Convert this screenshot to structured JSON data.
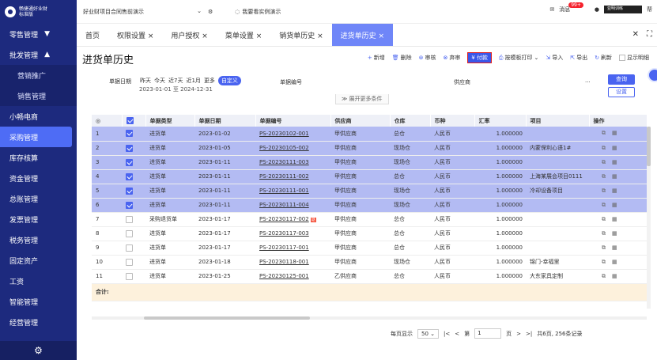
{
  "app": {
    "logo_line1": "畅捷通好业财",
    "logo_line2": "标准版"
  },
  "sidebar": {
    "items": [
      {
        "label": "零售管理",
        "arrow": "▼"
      },
      {
        "label": "批发管理",
        "arrow": "▲"
      },
      {
        "label": "营销推广"
      },
      {
        "label": "销售管理"
      },
      {
        "label": "小畅电商"
      },
      {
        "label": "采购管理"
      },
      {
        "label": "库存核算"
      },
      {
        "label": "资金管理"
      },
      {
        "label": "总账管理"
      },
      {
        "label": "发票管理"
      },
      {
        "label": "税务管理"
      },
      {
        "label": "固定资产"
      },
      {
        "label": "工资"
      },
      {
        "label": "智能管理"
      },
      {
        "label": "经营管理"
      }
    ],
    "bottom_icon": "gear-icon"
  },
  "topbar": {
    "project": "好业财项目合同售前演示",
    "demo_label": "我要看实例演示",
    "msg_label": "消息",
    "msg_count": "99+",
    "user": "亚明训练",
    "extra": "帮"
  },
  "tabs": [
    {
      "label": "首页"
    },
    {
      "label": "权限设置 ×"
    },
    {
      "label": "用户授权 ×"
    },
    {
      "label": "菜单设置 ×"
    },
    {
      "label": "销货单历史 ×"
    },
    {
      "label": "进货单历史 ×"
    }
  ],
  "page_title": "进货单历史",
  "actions": {
    "add": "新增",
    "delete": "删除",
    "audit": "审核",
    "abandon": "弃审",
    "pay": "付款",
    "print": "按模板打印",
    "import": "导入",
    "export": "导出",
    "refresh": "刷新",
    "show_detail": "显示明细"
  },
  "filter": {
    "date_label": "单据日期",
    "quick": [
      "昨天",
      "今天",
      "近7天",
      "近1月",
      "更多"
    ],
    "custom": "自定义",
    "range": "2023-01-01 至 2024-12-31",
    "code_label": "单据编号",
    "supplier_label": "供应商",
    "more": "...",
    "query": "查询",
    "settings": "设置",
    "expand": "≫ 展开更多条件"
  },
  "grid": {
    "headers": [
      "",
      "",
      "单据类型",
      "单据日期",
      "单据编号",
      "供应商",
      "仓库",
      "币种",
      "汇率",
      "项目",
      "操作"
    ],
    "rows": [
      {
        "n": "1",
        "sel": true,
        "type": "进货单",
        "date": "2023-01-02",
        "code": "PS-20230102-001",
        "supplier": "甲供应商",
        "wh": "总仓",
        "cur": "人民币",
        "rate": "1.000000",
        "proj": ""
      },
      {
        "n": "2",
        "sel": true,
        "type": "进货单",
        "date": "2023-01-05",
        "code": "PS-20230105-002",
        "supplier": "甲供应商",
        "wh": "现场仓",
        "cur": "人民币",
        "rate": "1.000000",
        "proj": "内蒙保利心语1#"
      },
      {
        "n": "3",
        "sel": true,
        "type": "进货单",
        "date": "2023-01-11",
        "code": "PS-20230111-003",
        "supplier": "甲供应商",
        "wh": "现场仓",
        "cur": "人民币",
        "rate": "1.000000",
        "proj": ""
      },
      {
        "n": "4",
        "sel": true,
        "type": "进货单",
        "date": "2023-01-11",
        "code": "PS-20230111-002",
        "supplier": "甲供应商",
        "wh": "总仓",
        "cur": "人民币",
        "rate": "1.000000",
        "proj": "上海某展会项目0111"
      },
      {
        "n": "5",
        "sel": true,
        "type": "进货单",
        "date": "2023-01-11",
        "code": "PS-20230111-001",
        "supplier": "甲供应商",
        "wh": "现场仓",
        "cur": "人民币",
        "rate": "1.000000",
        "proj": "冷却设备项目"
      },
      {
        "n": "6",
        "sel": true,
        "type": "进货单",
        "date": "2023-01-11",
        "code": "PS-20230111-004",
        "supplier": "甲供应商",
        "wh": "现场仓",
        "cur": "人民币",
        "rate": "1.000000",
        "proj": ""
      },
      {
        "n": "7",
        "sel": false,
        "type": "采购退货单",
        "date": "2023-01-17",
        "code": "PS-20230117-002",
        "refund": "退",
        "supplier": "甲供应商",
        "wh": "总仓",
        "cur": "人民币",
        "rate": "1.000000",
        "proj": ""
      },
      {
        "n": "8",
        "sel": false,
        "type": "进货单",
        "date": "2023-01-17",
        "code": "PS-20230117-003",
        "supplier": "甲供应商",
        "wh": "总仓",
        "cur": "人民币",
        "rate": "1.000000",
        "proj": ""
      },
      {
        "n": "9",
        "sel": false,
        "type": "进货单",
        "date": "2023-01-17",
        "code": "PS-20230117-001",
        "supplier": "甲供应商",
        "wh": "总仓",
        "cur": "人民币",
        "rate": "1.000000",
        "proj": ""
      },
      {
        "n": "10",
        "sel": false,
        "type": "进货单",
        "date": "2023-01-18",
        "code": "PS-20230118-001",
        "supplier": "甲供应商",
        "wh": "现场仓",
        "cur": "人民币",
        "rate": "1.000000",
        "proj": "锦门-幸福里"
      },
      {
        "n": "11",
        "sel": false,
        "type": "进货单",
        "date": "2023-01-25",
        "code": "PS-20230125-001",
        "supplier": "乙供应商",
        "wh": "总仓",
        "cur": "人民币",
        "rate": "1.000000",
        "proj": "大东家具定制"
      }
    ],
    "sum_label": "合计:"
  },
  "pager": {
    "per_page_label": "每页显示",
    "per_page": "50",
    "page_label": "第",
    "page": "1",
    "page_unit": "页",
    "total": "共6页, 256条记录"
  },
  "colors": {
    "sidebar": "#1d2a7e",
    "accent": "#4a64f0",
    "selected_row": "#b3bbf3",
    "sum_row": "#fdf1dc"
  }
}
